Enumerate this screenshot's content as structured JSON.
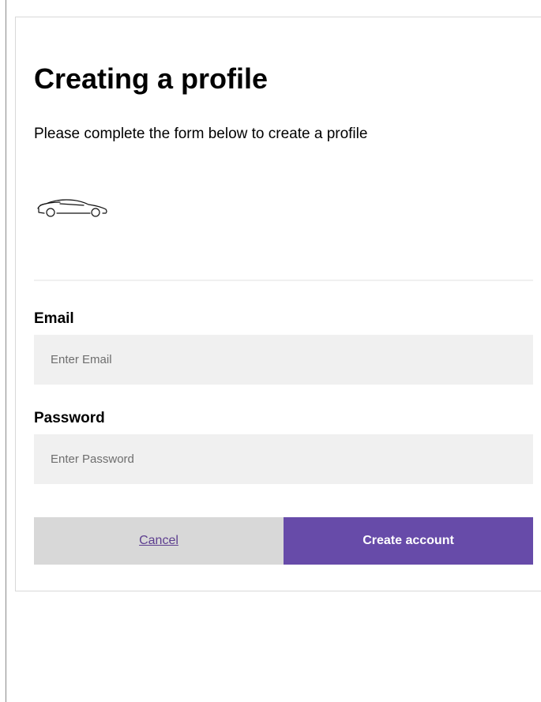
{
  "form": {
    "title": "Creating a profile",
    "subtitle": "Please complete the form below to create a profile",
    "logo_icon": "car-icon",
    "email": {
      "label": "Email",
      "placeholder": "Enter Email",
      "value": ""
    },
    "password": {
      "label": "Password",
      "placeholder": "Enter Password",
      "value": ""
    },
    "buttons": {
      "cancel_label": "Cancel",
      "create_label": "Create account"
    }
  },
  "colors": {
    "primary": "#674ba9",
    "link": "#5d3e8f",
    "field_bg": "#f0f0f0",
    "cancel_bg": "#d8d8d8"
  }
}
